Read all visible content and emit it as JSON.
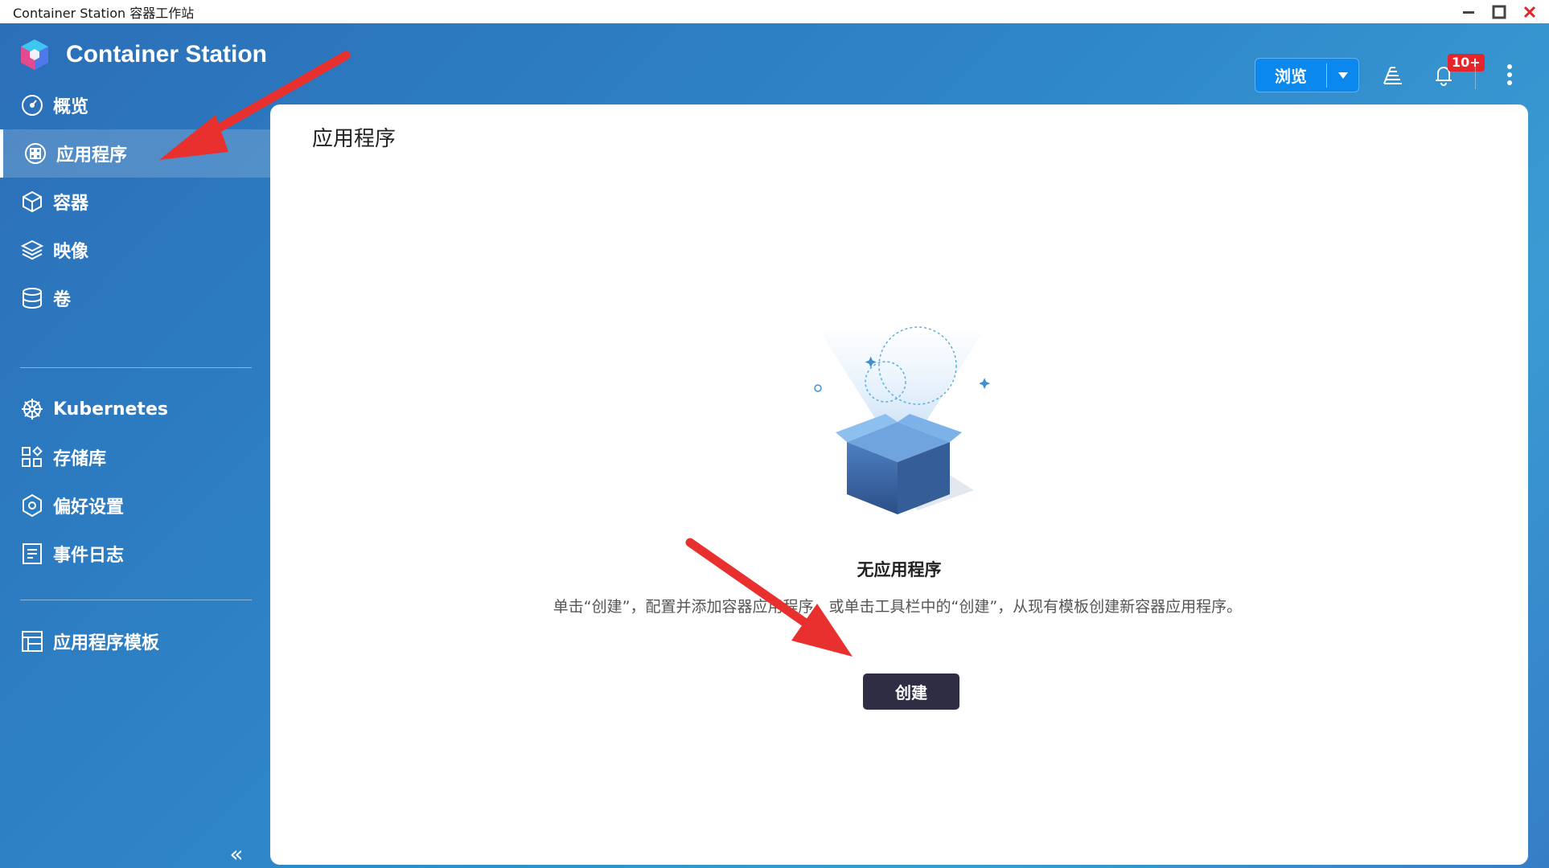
{
  "window": {
    "title": "Container Station 容器工作站",
    "controls": [
      "minimize-icon",
      "maximize-icon",
      "close-icon"
    ]
  },
  "app": {
    "name": "Container Station",
    "logo": "container-station-logo"
  },
  "sidebar": {
    "items": [
      {
        "label": "概览",
        "icon": "dashboard-gauge-icon",
        "active": false
      },
      {
        "label": "应用程序",
        "icon": "applications-grid-icon",
        "active": true
      },
      {
        "label": "容器",
        "icon": "container-cube-icon",
        "active": false
      },
      {
        "label": "映像",
        "icon": "image-layers-icon",
        "active": false
      },
      {
        "label": "卷",
        "icon": "volume-database-icon",
        "active": false
      },
      {
        "label": "Kubernetes",
        "icon": "kubernetes-helm-icon",
        "active": false
      },
      {
        "label": "存储库",
        "icon": "repository-grid-icon",
        "active": false
      },
      {
        "label": "偏好设置",
        "icon": "preferences-gear-icon",
        "active": false
      },
      {
        "label": "事件日志",
        "icon": "event-log-icon",
        "active": false
      },
      {
        "label": "应用程序模板",
        "icon": "app-template-icon",
        "active": false
      }
    ],
    "collapse_label": "«"
  },
  "toolbar": {
    "browse_label": "浏览",
    "notification_badge": "10+"
  },
  "main": {
    "title": "应用程序",
    "empty_title": "无应用程序",
    "empty_description": "单击“创建”，配置并添加容器应用程序，或单击工具栏中的“创建”，从现有模板创建新容器应用程序。",
    "create_label": "创建"
  },
  "colors": {
    "accent": "#0a88ee",
    "create_button": "#2e2d44",
    "annotation_arrow": "#e8312f",
    "badge": "#e5252a"
  }
}
